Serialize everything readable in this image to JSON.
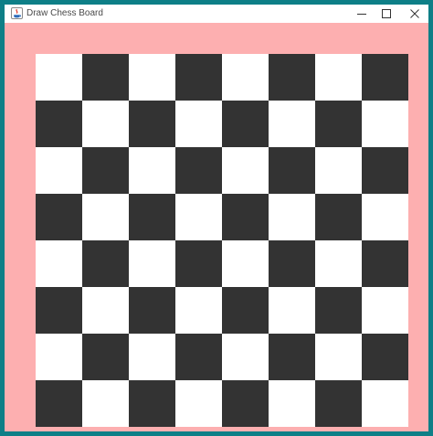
{
  "window": {
    "title": "Draw Chess Board",
    "app_icon": "java-app-icon",
    "frame_color": "#0e7f87",
    "titlebar_color": "#ffffff",
    "controls": {
      "minimize_icon": "minimize-icon",
      "maximize_icon": "maximize-icon",
      "close_icon": "close-icon"
    }
  },
  "panel": {
    "background_color": "#fdafb0"
  },
  "board": {
    "rows": 8,
    "columns": 8,
    "top_left_square": "light",
    "light_color": "#ffffff",
    "dark_color": "#333333"
  }
}
